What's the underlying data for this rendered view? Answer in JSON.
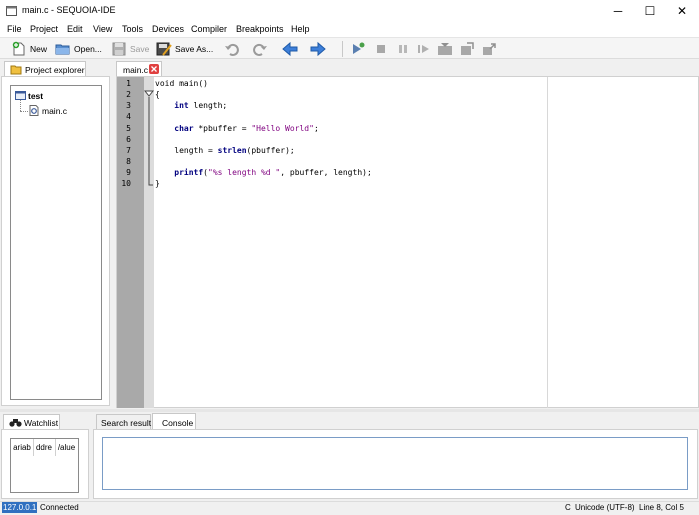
{
  "window": {
    "title": "main.c - SEQUOIA-IDE",
    "minimize": "─",
    "maximize": "☐",
    "close": "✕"
  },
  "menu": [
    "File",
    "Project",
    "Edit",
    "View",
    "Tools",
    "Devices",
    "Compiler",
    "Breakpoints",
    "Help"
  ],
  "toolbar": {
    "new": "New",
    "open": "Open...",
    "save": "Save",
    "save_as": "Save As...",
    "icons": [
      "undo-icon",
      "redo-icon",
      "back-arrow-icon",
      "forward-arrow-icon",
      "build-icon",
      "stop-icon",
      "pause-icon",
      "step-icon",
      "run-to-icon",
      "step-over-icon",
      "step-out-icon"
    ]
  },
  "explorer": {
    "tab_label": "Project explorer",
    "project": "test",
    "file": "main.c"
  },
  "editor": {
    "tab_label": "main.c",
    "line_numbers": [
      "1",
      "2",
      "3",
      "4",
      "5",
      "6",
      "7",
      "8",
      "9",
      "10"
    ]
  },
  "watchlist": {
    "tab_label": "Watchlist",
    "columns": [
      "ariab",
      "ddre",
      "/alue"
    ]
  },
  "bottom_tabs": {
    "search": "Search result",
    "console": "Console"
  },
  "status": {
    "ip": "127.0.0.1",
    "connection": "Connected",
    "mode": "C",
    "encoding": "Unicode (UTF-8)",
    "position": "Line 8, Col 5"
  },
  "colors": {
    "keyword": "#00007f",
    "string": "#7f007f",
    "gutter": "#a9a9a9",
    "status_highlight": "#3070c0"
  }
}
